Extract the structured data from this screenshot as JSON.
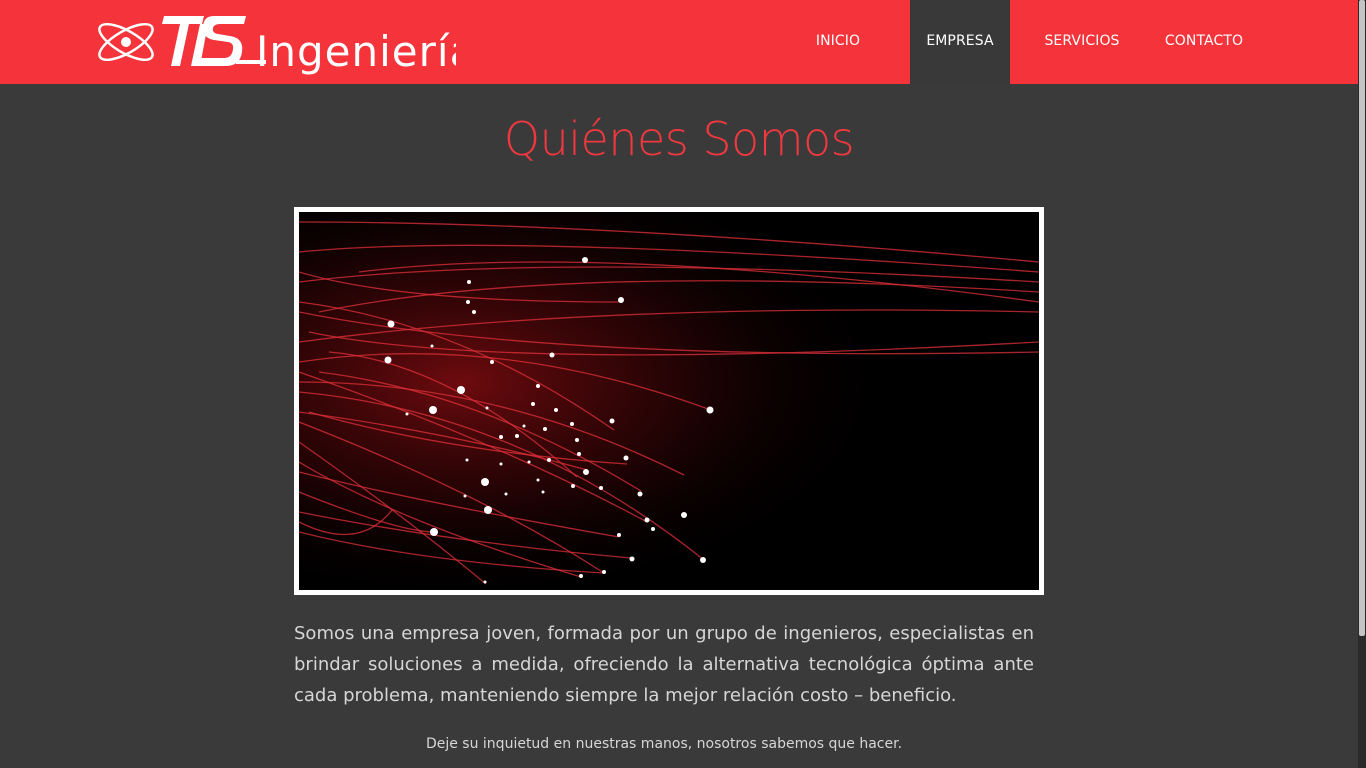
{
  "brand": {
    "logo_text": "TIS Ingeniería",
    "primary_color": "#f5333b",
    "background_color": "#3a3a3a"
  },
  "nav": {
    "items": [
      {
        "label": "INICIO",
        "active": false
      },
      {
        "label": "EMPRESA",
        "active": true
      },
      {
        "label": "SERVICIOS",
        "active": false
      },
      {
        "label": "CONTACTO",
        "active": false
      }
    ]
  },
  "main": {
    "title": "Quiénes Somos",
    "image_icon": "fiber-optic-image",
    "paragraph": "Somos una empresa joven, formada por un grupo de ingenieros, especialistas en brindar soluciones a medida, ofreciendo la alternativa tecnológica óptima ante cada problema, manteniendo siempre la mejor relación costo – beneficio.",
    "tagline": "Deje su inquietud en nuestras manos, nosotros sabemos que hacer."
  }
}
